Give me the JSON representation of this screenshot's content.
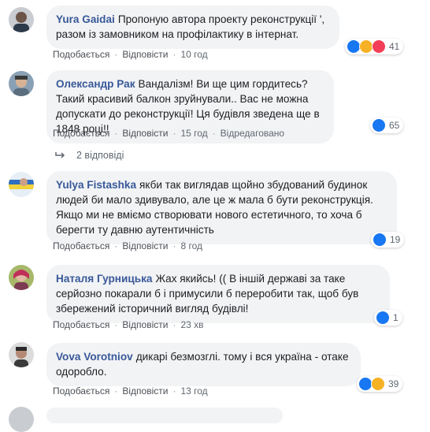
{
  "actions": {
    "like": "Подобається",
    "reply": "Відповісти",
    "separator": "·"
  },
  "comments": [
    {
      "author": "Yura Gaidai",
      "text": "Пропоную автора проекту реконструкції ', разом із замовником на профілактику в інтернат.",
      "time": "10 год",
      "extra": "",
      "reactions": [
        "like",
        "haha",
        "love"
      ],
      "count": "41"
    },
    {
      "author": "Олександр Рак",
      "text": "Вандалізм! Ви ще цим гордитесь? Такий красивий балкон зруйнували.. Вас не можна допускати до реконструкції! Ця будівля зведена ще в 1848 році!!",
      "time": "15 год",
      "extra": "Відредаговано",
      "reactions": [
        "like"
      ],
      "count": "65"
    },
    {
      "author": "Yulya Fistashka",
      "text": "якби так виглядав щойно збудований будинок людей би мало здивувало, але це ж мала б бути реконструкція. Якщо ми не вміємо створювати нового естетичного, то хоча б берегти ту давню аутентичність",
      "time": "8 год",
      "extra": "",
      "reactions": [
        "like"
      ],
      "count": "19"
    },
    {
      "author": "Наталя Гурницька",
      "text": "Жах якийсь! (( В іншій державі за таке серйозно покарали б і примусили б переробити так, щоб був збережений історичний вигляд будівлі!",
      "time": "23 хв",
      "extra": "",
      "reactions": [
        "like"
      ],
      "count": "1"
    },
    {
      "author": "Vova Vorotniov",
      "text": "дикарі безмозглі. тому і вся україна - отаке одоробло.",
      "time": "13 год",
      "extra": "",
      "reactions": [
        "like",
        "sad"
      ],
      "count": "39"
    }
  ],
  "replies": {
    "label": "2 відповіді"
  },
  "colors": {
    "author": "#385898",
    "bubble": "#f2f3f5",
    "like": "#1877f2",
    "love": "#f33e58",
    "haha": "#f7b125"
  }
}
